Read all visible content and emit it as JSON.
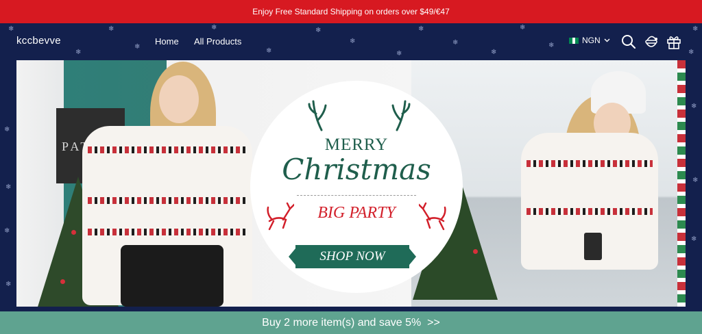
{
  "announcement": {
    "text": "Enjoy Free Standard Shipping on orders over $49/€47"
  },
  "header": {
    "logo": "kccbevve",
    "nav": [
      {
        "label": "Home"
      },
      {
        "label": "All Products"
      }
    ],
    "currency": {
      "code": "NGN",
      "flag_colors": [
        "#008751",
        "#ffffff",
        "#008751"
      ]
    },
    "icons": [
      "search-icon",
      "santa-cart-icon",
      "gift-icon"
    ]
  },
  "banner": {
    "headline_top": "MERRY",
    "headline_main": "Christmas",
    "subheadline": "BIG PARTY",
    "cta": "SHOP NOW",
    "sign_text": "PATA"
  },
  "promo_bar": {
    "text": "Buy 2 more item(s) and save 5%  >>"
  },
  "colors": {
    "announcement_bg": "#d71921",
    "header_bg": "#13204d",
    "brand_green": "#1f6b58",
    "accent_red": "#d21f2a",
    "promo_bg": "#5fa390"
  }
}
